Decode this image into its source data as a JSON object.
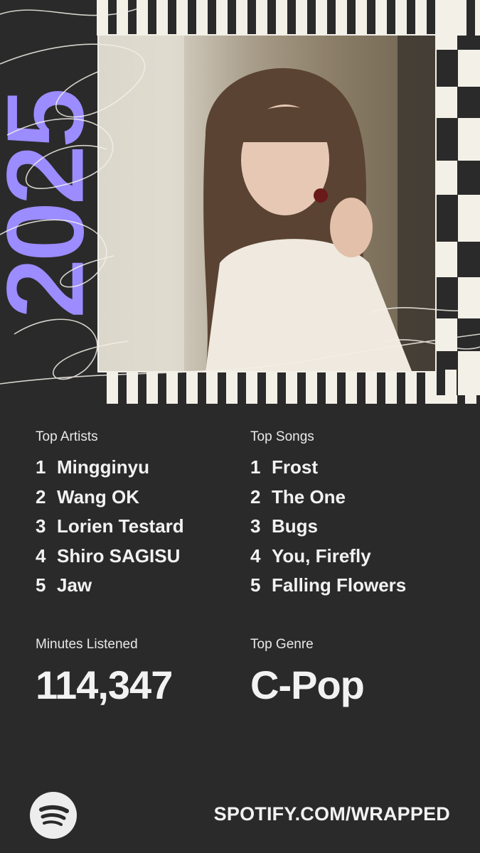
{
  "year": "2025",
  "colors": {
    "background": "#2a2a2a",
    "accent": "#9b8cff",
    "light": "#f3f0e8"
  },
  "top_artists": {
    "label": "Top Artists",
    "items": [
      {
        "rank": "1",
        "name": "Mingginyu"
      },
      {
        "rank": "2",
        "name": "Wang OK"
      },
      {
        "rank": "3",
        "name": "Lorien Testard"
      },
      {
        "rank": "4",
        "name": "Shiro SAGISU"
      },
      {
        "rank": "5",
        "name": "Jaw"
      }
    ]
  },
  "top_songs": {
    "label": "Top Songs",
    "items": [
      {
        "rank": "1",
        "name": "Frost"
      },
      {
        "rank": "2",
        "name": "The One"
      },
      {
        "rank": "3",
        "name": "Bugs"
      },
      {
        "rank": "4",
        "name": "You, Firefly"
      },
      {
        "rank": "5",
        "name": "Falling Flowers"
      }
    ]
  },
  "minutes": {
    "label": "Minutes Listened",
    "value": "114,347"
  },
  "genre": {
    "label": "Top Genre",
    "value": "C-Pop"
  },
  "footer": {
    "url": "SPOTIFY.COM/WRAPPED",
    "logo_icon": "spotify-logo-icon"
  }
}
